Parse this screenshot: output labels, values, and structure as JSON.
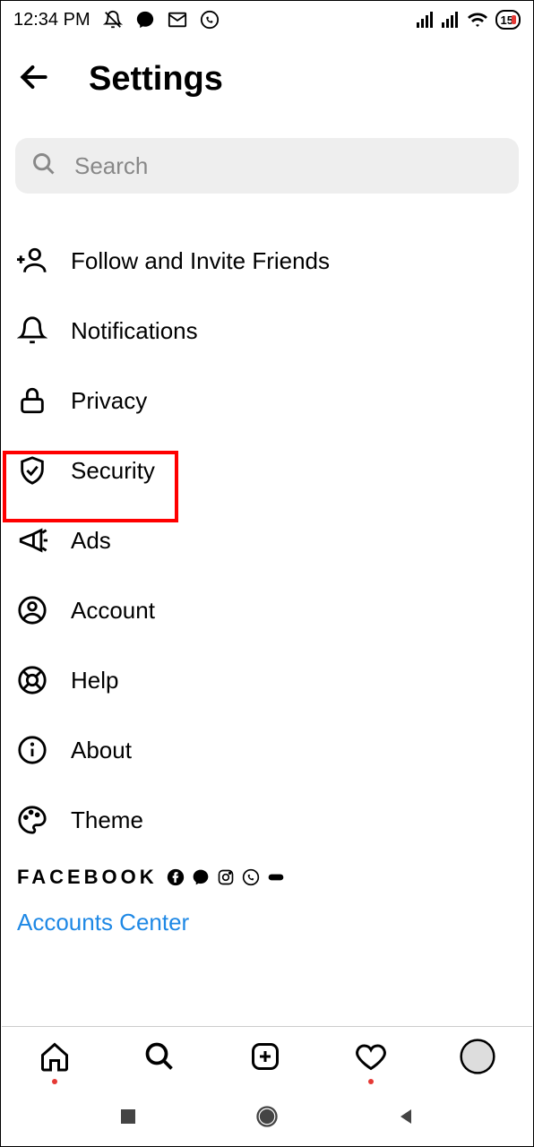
{
  "status": {
    "time": "12:34 PM",
    "battery": "15"
  },
  "header": {
    "title": "Settings"
  },
  "search": {
    "placeholder": "Search"
  },
  "menu": {
    "items": [
      {
        "label": "Follow and Invite Friends"
      },
      {
        "label": "Notifications"
      },
      {
        "label": "Privacy"
      },
      {
        "label": "Security"
      },
      {
        "label": "Ads"
      },
      {
        "label": "Account"
      },
      {
        "label": "Help"
      },
      {
        "label": "About"
      },
      {
        "label": "Theme"
      }
    ]
  },
  "footer": {
    "facebook_label": "FACEBOOK",
    "accounts_center": "Accounts Center"
  }
}
